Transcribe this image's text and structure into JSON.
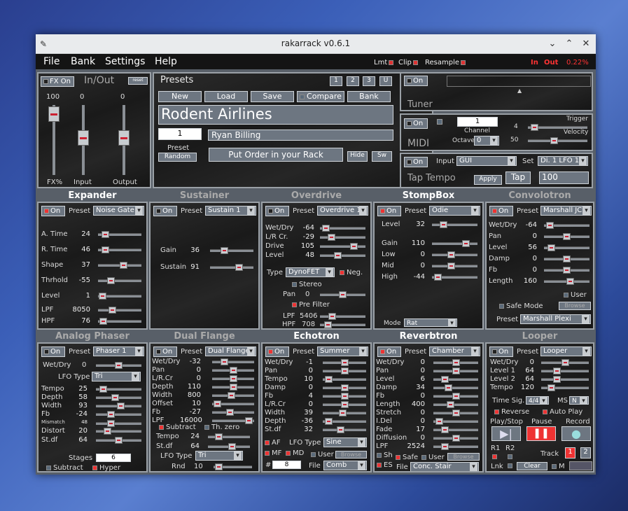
{
  "window": {
    "title": "rakarrack v0.6.1"
  },
  "menu": {
    "file": "File",
    "bank": "Bank",
    "settings": "Settings",
    "help": "Help"
  },
  "status": {
    "lmt": "Lmt",
    "clip": "Clip",
    "resample": "Resample",
    "in_label": "In",
    "out_label": "Out",
    "cpu": "0.22%"
  },
  "inout": {
    "title": "In/Out",
    "fx_on": "FX On",
    "reset": "reset",
    "fx_val": "100",
    "input_val": "0",
    "output_val": "0",
    "fx_lbl": "FX%",
    "input_lbl": "Input",
    "output_lbl": "Output"
  },
  "presets": {
    "title": "Presets",
    "btn1": "1",
    "btn2": "2",
    "btn3": "3",
    "btnU": "U",
    "new": "New",
    "load": "Load",
    "save": "Save",
    "compare": "Compare",
    "bank": "Bank",
    "name": "Rodent Airlines",
    "number": "1",
    "author": "Ryan Billing",
    "preset_lbl": "Preset",
    "random": "Random",
    "order": "Put Order in your Rack",
    "hide": "Hide",
    "sw": "Sw"
  },
  "tuner": {
    "on": "On",
    "label": "Tuner"
  },
  "midi": {
    "on": "On",
    "label": "MIDI",
    "channel": "1",
    "channel_lbl": "Channel",
    "octave_lbl": "Octave",
    "octave": "0",
    "trigger_lbl": "Trigger",
    "trigger_val": "4",
    "velocity_lbl": "Velocity",
    "velocity_val": "50"
  },
  "tap": {
    "on": "On",
    "label": "Tap Tempo",
    "input_lbl": "Input",
    "input": "GUI",
    "set_lbl": "Set",
    "set": "Di. 1 LFO 1",
    "apply": "Apply",
    "tap": "Tap",
    "tempo": "100"
  },
  "expander": {
    "title": "Expander",
    "on": "On",
    "preset_lbl": "Preset",
    "preset": "Noise Gate",
    "rows": [
      [
        "A. Time",
        "24"
      ],
      [
        "R. Time",
        "46"
      ],
      [
        "Shape",
        "37"
      ],
      [
        "Thrhold",
        "-55"
      ],
      [
        "Level",
        "1"
      ],
      [
        "LPF",
        "8050"
      ],
      [
        "HPF",
        "76"
      ]
    ]
  },
  "sustainer": {
    "title": "Sustainer",
    "on": "On",
    "preset_lbl": "Preset",
    "preset": "Sustain 1",
    "rows": [
      [
        "Gain",
        "36"
      ],
      [
        "Sustain",
        "91"
      ]
    ]
  },
  "overdrive": {
    "title": "Overdrive",
    "on": "On",
    "preset_lbl": "Preset",
    "preset": "Overdrive 1",
    "rows": [
      [
        "Wet/Dry",
        "-64"
      ],
      [
        "L/R Cr.",
        "-29"
      ],
      [
        "Drive",
        "105"
      ],
      [
        "Level",
        "48"
      ]
    ],
    "type_lbl": "Type",
    "type": "DynoFET",
    "neg": "Neg.",
    "stereo": "Stereo",
    "pan_lbl": "Pan",
    "pan": "0",
    "prefilter": "Pre Filter",
    "lpf_lbl": "LPF",
    "lpf": "5406",
    "hpf_lbl": "HPF",
    "hpf": "708"
  },
  "stompbox": {
    "title": "StompBox",
    "on": "On",
    "preset_lbl": "Preset",
    "preset": "Odie",
    "rows": [
      [
        "Level",
        "32"
      ],
      [
        "Gain",
        "110"
      ],
      [
        "Low",
        "0"
      ],
      [
        "Mid",
        "0"
      ],
      [
        "High",
        "-44"
      ]
    ],
    "mode_lbl": "Mode",
    "mode": "Rat"
  },
  "convolotron": {
    "title": "Convolotron",
    "on": "On",
    "preset_lbl": "Preset",
    "preset": "Marshall JCM",
    "rows": [
      [
        "Wet/Dry",
        "-64"
      ],
      [
        "Pan",
        "0"
      ],
      [
        "Level",
        "56"
      ],
      [
        "Damp",
        "0"
      ],
      [
        "Fb",
        "0"
      ],
      [
        "Length",
        "160"
      ]
    ],
    "user": "User",
    "safe": "Safe Mode",
    "browse": "Browse",
    "preset2_lbl": "Preset",
    "preset2": "Marshall Plexi"
  },
  "phaser": {
    "title": "Analog Phaser",
    "on": "On",
    "preset_lbl": "Preset",
    "preset": "Phaser 1",
    "wet_lbl": "Wet/Dry",
    "wet": "0",
    "lfo_lbl": "LFO Type",
    "lfo": "Tri",
    "rows": [
      [
        "Tempo",
        "25"
      ],
      [
        "Depth",
        "58"
      ],
      [
        "Width",
        "93"
      ],
      [
        "Fb",
        "-24"
      ],
      [
        "Mismatch",
        "48"
      ],
      [
        "Distort",
        "20"
      ],
      [
        "St.df",
        "64"
      ]
    ],
    "stages_lbl": "Stages",
    "stages": "6",
    "subtract": "Subtract",
    "hyper": "Hyper"
  },
  "flange": {
    "title": "Dual Flange",
    "on": "On",
    "preset_lbl": "Preset",
    "preset": "Dual Flange",
    "rows": [
      [
        "Wet/Dry",
        "-32"
      ],
      [
        "Pan",
        "0"
      ],
      [
        "L/R.Cr",
        "0"
      ],
      [
        "Depth",
        "110"
      ],
      [
        "Width",
        "800"
      ],
      [
        "Offset",
        "10"
      ],
      [
        "Fb",
        "-27"
      ],
      [
        "LPF",
        "16000"
      ]
    ],
    "subtract": "Subtract",
    "thzero": "Th. zero",
    "rows2": [
      [
        "Tempo",
        "24"
      ],
      [
        "St.df",
        "64"
      ]
    ],
    "lfo_lbl": "LFO Type",
    "lfo": "Tri",
    "rnd_lbl": "Rnd",
    "rnd": "10"
  },
  "echotron": {
    "title": "Echotron",
    "on": "On",
    "preset_lbl": "Preset",
    "preset": "Summer",
    "rows": [
      [
        "Wet/Dry",
        "-1"
      ],
      [
        "Pan",
        "0"
      ],
      [
        "Tempo",
        "10"
      ],
      [
        "Damp",
        "0"
      ],
      [
        "Fb",
        "4"
      ],
      [
        "L/R.Cr",
        "0"
      ],
      [
        "Width",
        "39"
      ],
      [
        "Depth",
        "-36"
      ],
      [
        "St.df",
        "32"
      ]
    ],
    "af": "AF",
    "lfo_lbl": "LFO Type",
    "lfo": "Sine",
    "mf": "MF",
    "md": "MD",
    "user": "User",
    "browse": "Browse",
    "hash": "#",
    "num": "8",
    "file_lbl": "File",
    "file": "Comb"
  },
  "reverbtron": {
    "title": "Reverbtron",
    "on": "On",
    "preset_lbl": "Preset",
    "preset": "Chamber",
    "rows": [
      [
        "Wet/Dry",
        "0"
      ],
      [
        "Pan",
        "0"
      ],
      [
        "Level",
        "6"
      ],
      [
        "Damp",
        "34"
      ],
      [
        "Fb",
        "0"
      ],
      [
        "Length",
        "400"
      ],
      [
        "Stretch",
        "0"
      ],
      [
        "I.Del",
        "0"
      ],
      [
        "Fade",
        "17"
      ],
      [
        "Diffusion",
        "0"
      ],
      [
        "LPF",
        "2524"
      ]
    ],
    "sh": "Sh",
    "safe": "Safe",
    "user": "User",
    "browse": "Browse",
    "es": "ES",
    "file_lbl": "File",
    "file": "Conc. Stair"
  },
  "looper": {
    "title": "Looper",
    "on": "On",
    "preset_lbl": "Preset",
    "preset": "Looper",
    "rows": [
      [
        "Wet/Dry",
        "0"
      ],
      [
        "Level 1",
        "64"
      ],
      [
        "Level 2",
        "64"
      ],
      [
        "Tempo",
        "120"
      ]
    ],
    "timesig_lbl": "Time Sig.",
    "timesig": "4/4",
    "ms_lbl": "MS",
    "ms": "N",
    "reverse": "Reverse",
    "autoplay": "Auto Play",
    "play_lbl": "Play/Stop",
    "pause_lbl": "Pause",
    "record_lbl": "Record",
    "r1": "R1",
    "r2": "R2",
    "track_lbl": "Track",
    "t1": "1",
    "t2": "2",
    "lnk": "Lnk",
    "clear": "Clear",
    "m": "M"
  },
  "colors": {
    "panel_bg": "#1e1e1e",
    "border": "#9aa0a6",
    "accent_red": "#e33333",
    "button": "#6d7681"
  }
}
